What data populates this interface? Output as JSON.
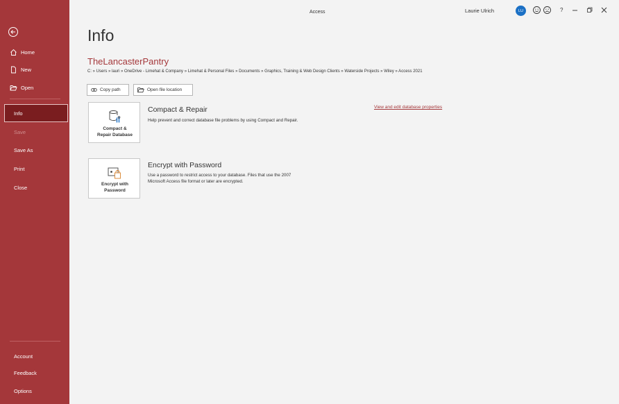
{
  "sidebar": {
    "items": [
      {
        "label": "Home"
      },
      {
        "label": "New"
      },
      {
        "label": "Open"
      },
      {
        "label": "Info"
      },
      {
        "label": "Save"
      },
      {
        "label": "Save As"
      },
      {
        "label": "Print"
      },
      {
        "label": "Close"
      }
    ],
    "footer_items": [
      {
        "label": "Account"
      },
      {
        "label": "Feedback"
      },
      {
        "label": "Options"
      }
    ]
  },
  "titlebar": {
    "app_title": "Access",
    "user_name": "Laurie Ulrich",
    "user_initials": "LU",
    "help_label": "?"
  },
  "main": {
    "page_title": "Info",
    "db_name": "TheLancasterPantry",
    "db_path": "C: » Users » lauri » OneDrive - Limehat & Company » Limehat & Personal Files » Documents » Graphics, Training  & Web Design Clients » Waterside Projects » Wiley » Access 2021",
    "copy_path_label": "Copy path",
    "open_location_label": "Open file location",
    "properties_link": "View and edit database properties",
    "sections": [
      {
        "button_line1": "Compact &",
        "button_line2": "Repair Database",
        "heading": "Compact & Repair",
        "desc_line1": "Help prevent and correct database file problems by using Compact and Repair.",
        "desc_line2": ""
      },
      {
        "button_line1": "Encrypt with",
        "button_line2": "Password",
        "heading": "Encrypt with Password",
        "desc_line1": "Use a password to restrict access to your database. Files that use the 2007",
        "desc_line2": "Microsoft Access file format or later are encrypted."
      }
    ]
  },
  "colors": {
    "brand": "#a4373a",
    "selected": "#7a1d1f",
    "avatar": "#1b70c5"
  }
}
